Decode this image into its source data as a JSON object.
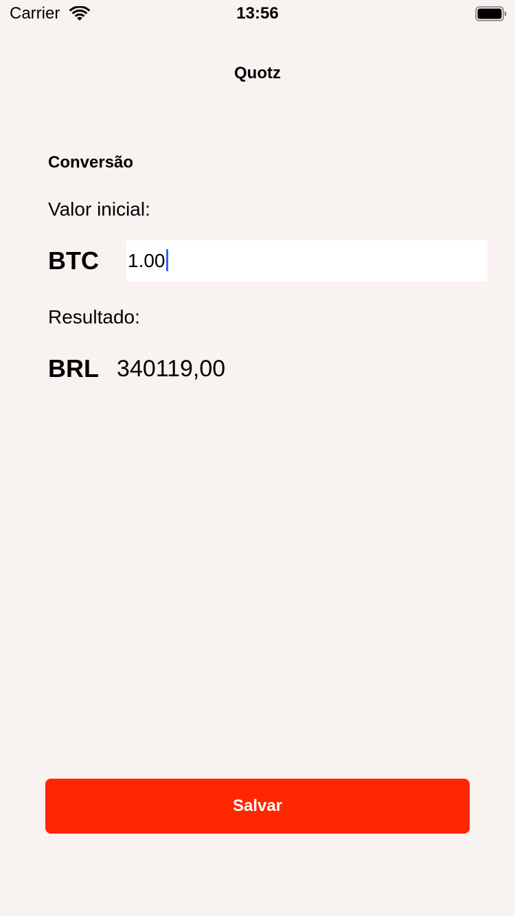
{
  "status_bar": {
    "carrier": "Carrier",
    "time": "13:56",
    "icons": [
      "wifi-icon",
      "battery-icon"
    ]
  },
  "nav": {
    "title": "Quotz"
  },
  "conversion": {
    "section_title": "Conversão",
    "initial_label": "Valor inicial:",
    "from_currency": "BTC",
    "input_value": "1.00",
    "result_label": "Resultado:",
    "to_currency": "BRL",
    "result_value": "340119,00"
  },
  "actions": {
    "save_label": "Salvar"
  },
  "colors": {
    "background": "#f8f2f1",
    "button": "#ff2600",
    "button_text": "#ffffff",
    "input_background": "#ffffff",
    "caret": "#3a5bf0"
  }
}
